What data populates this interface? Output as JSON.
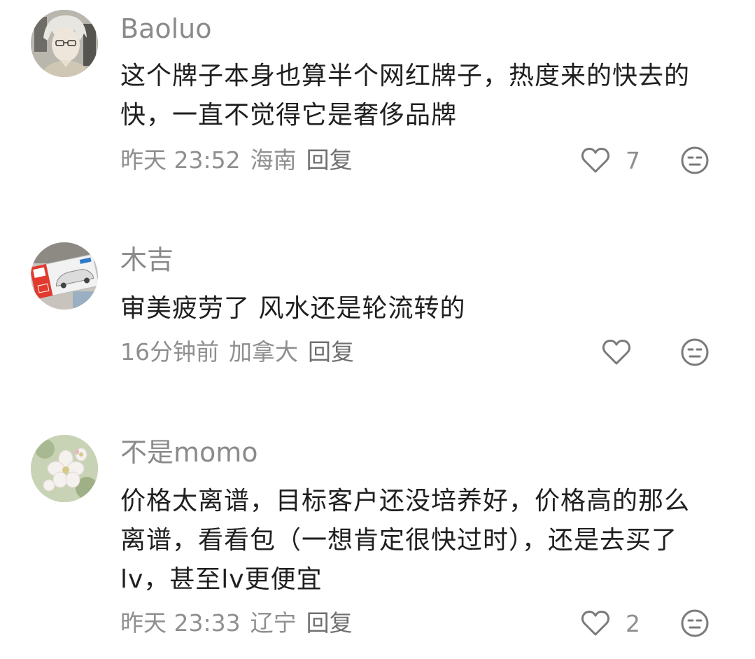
{
  "comments": [
    {
      "username": "Baoluo",
      "text": "这个牌子本身也算半个网红牌子，热度来的快去的快，一直不觉得它是奢侈品牌",
      "time": "昨天 23:52",
      "location": "海南",
      "reply_label": "回复",
      "likes": "7",
      "avatar_icon": "anime-boy-avatar"
    },
    {
      "username": "木吉",
      "text": "审美疲劳了 风水还是轮流转的",
      "time": "16分钟前",
      "location": "加拿大",
      "reply_label": "回复",
      "likes": "",
      "avatar_icon": "toy-car-box-avatar"
    },
    {
      "username": "不是momo",
      "text": "价格太离谱，目标客户还没培养好，价格高的那么离谱，看看包（一想肯定很快过时），还是去买了lv，甚至lv更便宜",
      "time": "昨天 23:33",
      "location": "辽宁",
      "reply_label": "回复",
      "likes": "2",
      "avatar_icon": "flower-avatar"
    }
  ],
  "colors": {
    "username": "#8a8a8a",
    "text": "#1f1f1f",
    "meta": "#8f8f8f",
    "icon": "#7a7a7a"
  },
  "icons": {
    "like": "heart-outline-icon",
    "emoji": "meh-face-icon"
  }
}
